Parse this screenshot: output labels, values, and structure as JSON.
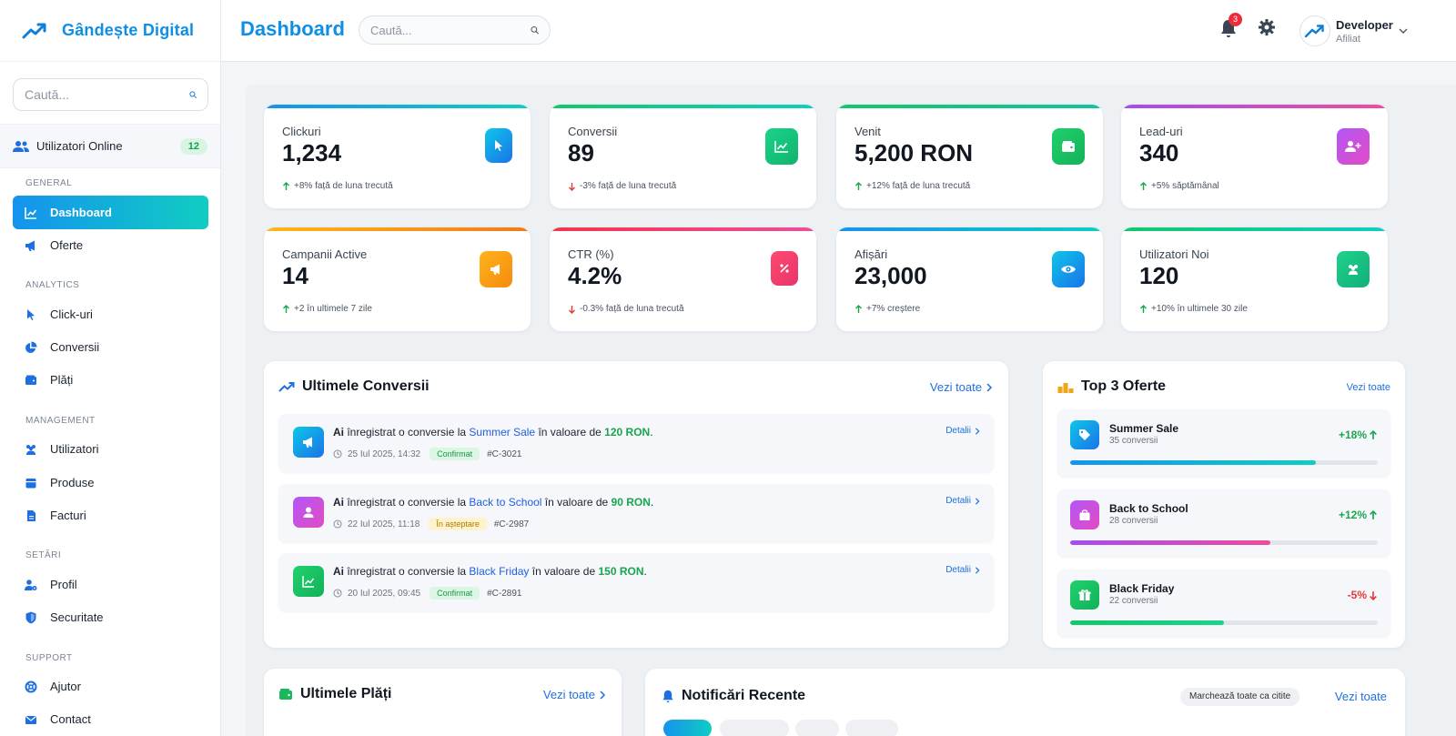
{
  "brand": {
    "name": "Gândește Digital"
  },
  "sidebar": {
    "search_placeholder": "Caută...",
    "online": {
      "label": "Utilizatori Online",
      "count": "12"
    },
    "sections": [
      "GENERAL",
      "ANALYTICS",
      "MANAGEMENT",
      "SETĂRI",
      "SUPPORT"
    ],
    "items": [
      {
        "label": "Dashboard",
        "icon": "chart-line-icon"
      },
      {
        "label": "Oferte",
        "icon": "megaphone-icon"
      },
      {
        "label": "Click-uri",
        "icon": "cursor-icon"
      },
      {
        "label": "Conversii",
        "icon": "pie-chart-icon"
      },
      {
        "label": "Plăți",
        "icon": "wallet-icon"
      },
      {
        "label": "Utilizatori",
        "icon": "users-icon"
      },
      {
        "label": "Produse",
        "icon": "box-icon"
      },
      {
        "label": "Facturi",
        "icon": "invoice-icon"
      },
      {
        "label": "Profil",
        "icon": "user-gear-icon"
      },
      {
        "label": "Securitate",
        "icon": "shield-icon"
      },
      {
        "label": "Ajutor",
        "icon": "lifebuoy-icon"
      },
      {
        "label": "Contact",
        "icon": "envelope-icon"
      }
    ]
  },
  "header": {
    "title": "Dashboard",
    "search_placeholder": "Caută...",
    "notifications_count": "3",
    "user": {
      "name": "Developer",
      "role": "Afiliat"
    }
  },
  "stats": [
    {
      "label": "Clickuri",
      "value": "1,234",
      "trend": "+8% față de luna trecută",
      "direction": "up",
      "icon": "cursor-icon"
    },
    {
      "label": "Conversii",
      "value": "89",
      "trend": "-3% față de luna trecută",
      "direction": "down",
      "icon": "chart-line-icon"
    },
    {
      "label": "Venit",
      "value": "5,200 RON",
      "trend": "+12% față de luna trecută",
      "direction": "up",
      "icon": "wallet-icon"
    },
    {
      "label": "Lead-uri",
      "value": "340",
      "trend": "+5% săptămânal",
      "direction": "up",
      "icon": "user-plus-icon"
    },
    {
      "label": "Campanii Active",
      "value": "14",
      "trend": "+2 în ultimele 7 zile",
      "direction": "up",
      "icon": "megaphone-icon"
    },
    {
      "label": "CTR (%)",
      "value": "4.2%",
      "trend": "-0.3% față de luna trecută",
      "direction": "down",
      "icon": "percent-icon"
    },
    {
      "label": "Afișări",
      "value": "23,000",
      "trend": "+7% creștere",
      "direction": "up",
      "icon": "eye-icon"
    },
    {
      "label": "Utilizatori Noi",
      "value": "120",
      "trend": "+10% în ultimele 30 zile",
      "direction": "up",
      "icon": "users-icon"
    }
  ],
  "conversions": {
    "title": "Ultimele Conversii",
    "view_all": "Vezi toate",
    "items": [
      {
        "prefix": "Ai",
        "text1": " înregistrat o conversie la ",
        "offer": "Summer Sale",
        "text2": " în valoare de ",
        "amount": "120 RON",
        "end": ".",
        "date": "25 Iul 2025, 14:32",
        "status": "Confirmat",
        "id": "#C-3021",
        "details": "Detalii"
      },
      {
        "prefix": "Ai",
        "text1": " înregistrat o conversie la ",
        "offer": "Back to School",
        "text2": " în valoare de ",
        "amount": "90 RON",
        "end": ".",
        "date": "22 Iul 2025, 11:18",
        "status": "În așteptare",
        "id": "#C-2987",
        "details": "Detalii"
      },
      {
        "prefix": "Ai",
        "text1": " înregistrat o conversie la ",
        "offer": "Black Friday",
        "text2": " în valoare de ",
        "amount": "150 RON",
        "end": ".",
        "date": "20 Iul 2025, 09:45",
        "status": "Confirmat",
        "id": "#C-2891",
        "details": "Detalii"
      }
    ]
  },
  "top_offers": {
    "title": "Top 3 Oferte",
    "view_all": "Vezi toate",
    "items": [
      {
        "name": "Summer Sale",
        "conversions": "35 conversii",
        "change": "+18%",
        "direction": "up",
        "progress": 0.8
      },
      {
        "name": "Back to School",
        "conversions": "28 conversii",
        "change": "+12%",
        "direction": "up",
        "progress": 0.65
      },
      {
        "name": "Black Friday",
        "conversions": "22 conversii",
        "change": "-5%",
        "direction": "down",
        "progress": 0.5
      }
    ]
  },
  "payments": {
    "title": "Ultimele Plăți",
    "view_all": "Vezi toate"
  },
  "notifications": {
    "title": "Notificări Recente",
    "mark_all": "Marchează toate ca citite",
    "view_all": "Vezi toate"
  },
  "colors": {
    "accent": "#0e8fe6",
    "success": "#19a54d",
    "danger": "#e53935"
  }
}
